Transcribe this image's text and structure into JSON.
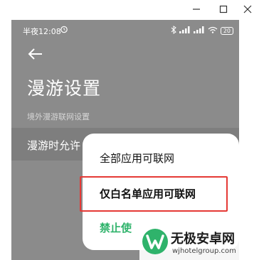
{
  "status_bar": {
    "time": "半夜12:08",
    "battery": "20"
  },
  "page": {
    "title": "漫游设置",
    "section_label": "境外漫游联网设置",
    "row_label": "漫游时允许"
  },
  "popup": {
    "options": [
      "全部应用可联网",
      "仅白名单应用可联网",
      "禁止使"
    ],
    "selected_index": 2
  },
  "watermark": {
    "main": "无极安卓网",
    "url": "wjhotelgroup.com"
  },
  "colors": {
    "dim_background": "#8b8b8b",
    "highlight_box": "#e53935",
    "accent_green": "#2fb36b"
  }
}
